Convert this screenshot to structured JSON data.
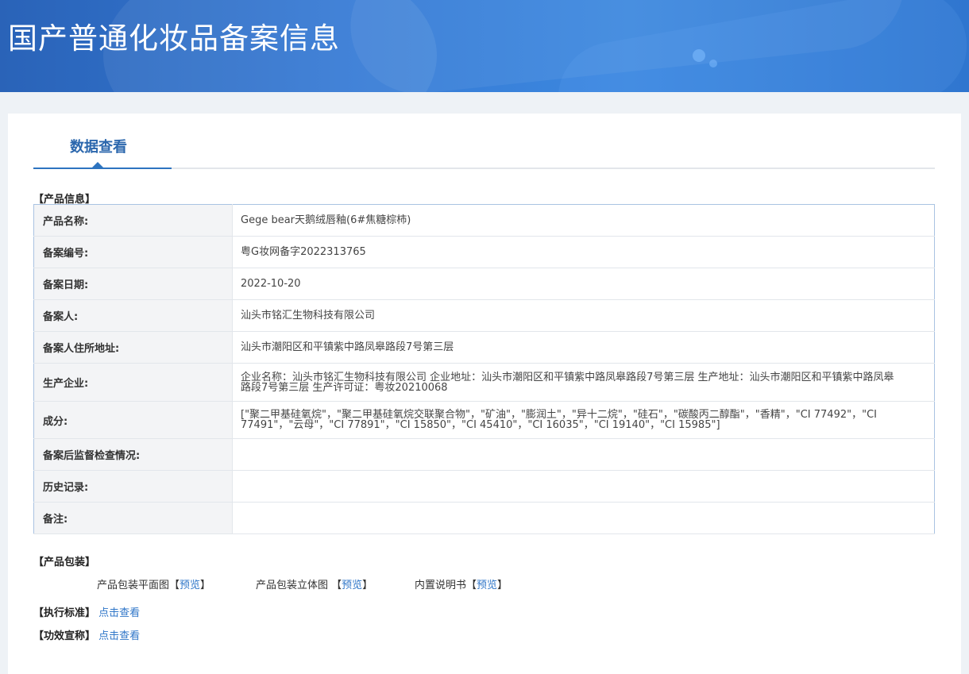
{
  "banner": {
    "title": "国产普通化妆品备案信息"
  },
  "tab": {
    "label": "数据查看"
  },
  "product_info": {
    "section_title": "【产品信息】",
    "rows": [
      {
        "label": "产品名称:",
        "value": "Gege bear天鹅绒唇釉(6#焦糖棕柿)"
      },
      {
        "label": "备案编号:",
        "value": "粤G妆网备字2022313765"
      },
      {
        "label": "备案日期:",
        "value": "2022-10-20"
      },
      {
        "label": "备案人:",
        "value": "汕头市铭汇生物科技有限公司"
      },
      {
        "label": "备案人住所地址:",
        "value": "汕头市潮阳区和平镇紫中路凤皋路段7号第三层"
      },
      {
        "label": "生产企业:",
        "value": "企业名称：汕头市铭汇生物科技有限公司 企业地址：汕头市潮阳区和平镇紫中路凤皋路段7号第三层 生产地址：汕头市潮阳区和平镇紫中路凤皋路段7号第三层 生产许可证：粤妆20210068"
      },
      {
        "label": "成分:",
        "value": "[\"聚二甲基硅氧烷\"，\"聚二甲基硅氧烷交联聚合物\"，\"矿油\"，\"膨润土\"，\"异十二烷\"，\"硅石\"，\"碳酸丙二醇酯\"，\"香精\"，\"CI 77492\"，\"CI 77491\"，\"云母\"，\"CI 77891\"，\"CI 15850\"，\"CI 45410\"，\"CI 16035\"，\"CI 19140\"，\"CI 15985\"]"
      },
      {
        "label": "备案后监督检查情况:",
        "value": ""
      },
      {
        "label": "历史记录:",
        "value": ""
      },
      {
        "label": "备注:",
        "value": ""
      }
    ]
  },
  "packaging": {
    "section_title": "【产品包装】",
    "items": [
      {
        "label": "产品包装平面图",
        "open": "【",
        "link": "预览",
        "close": "】"
      },
      {
        "label": "产品包装立体图 ",
        "open": "【",
        "link": "预览",
        "close": "】"
      },
      {
        "label": "内置说明书",
        "open": "【",
        "link": "预览",
        "close": "】"
      }
    ]
  },
  "standard": {
    "label": "【执行标准】",
    "link": "点击查看"
  },
  "efficacy": {
    "label": "【功效宣称】",
    "link": "点击查看"
  }
}
